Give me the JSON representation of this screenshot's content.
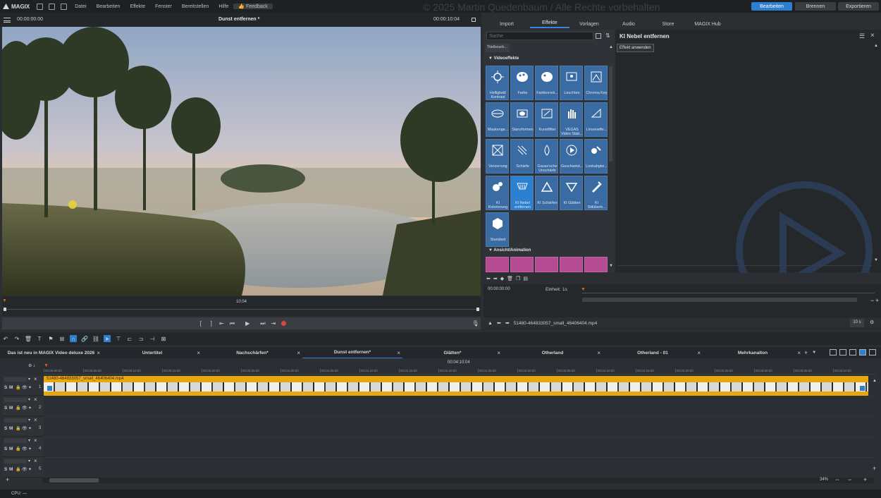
{
  "app": {
    "logo": "MAGIX",
    "watermark": "© 2025 Martin Quedenbaum / Alle Rechte vorbehalten"
  },
  "menu": {
    "items": [
      "Datei",
      "Bearbeiten",
      "Effekte",
      "Fenster",
      "Bereitstellen",
      "Hilfe"
    ],
    "feedback": "Feedback"
  },
  "modes": {
    "edit": "Bearbeiten",
    "burn": "Brennen",
    "export": "Exportieren"
  },
  "player": {
    "tc_left": "00:00:00:00",
    "title": "Dunst entfernen *",
    "tc_right": "00:00:10:04",
    "marker": "10:04"
  },
  "media_tabs": [
    "Import",
    "Effekte",
    "Vorlagen",
    "Audio",
    "Store",
    "MAGIX Hub"
  ],
  "fx": {
    "search_placeholder": "Suche",
    "crumb": "Titelbearb...",
    "section_video": "Videoeffekte",
    "section_anim": "Ansicht/Animation",
    "tiles": [
      "Helligkeit/ Kontrast",
      "Farbe",
      "Farbkorrek...",
      "Leuchten",
      "Chroma Key",
      "Maskenge...",
      "Stanzformen",
      "Kunstfilter",
      "VEGAS Video Stab...",
      "Linseneffe...",
      "Verzerrung",
      "Schärfe",
      "Gauss'sche Unschärfe",
      "Geschwind...",
      "Lookabglei...",
      "KI Kolorierung",
      "KI Nebel entfernen",
      "KI Schärfen",
      "KI Glätten",
      "KI Stilübertr...",
      "Standard"
    ]
  },
  "effect_panel": {
    "title": "KI Nebel entfernen",
    "apply": "Effekt anwenden"
  },
  "effect_timeline": {
    "tc": "00:00:00:00",
    "unit_label": "Einheit:",
    "unit_value": "1s",
    "file": "51480-464833057_small_46406404.mp4",
    "zoom": "10 s"
  },
  "project_tabs": [
    "Das ist neu in MAGIX Video deluxe 2026",
    "Untertitel",
    "Nachschärfen*",
    "Dunst entfernen*",
    "Glätten*",
    "Otherland",
    "Otherland - 01",
    "Mehrkanalton"
  ],
  "arranger": {
    "playhead_tc": "00:04:10:04",
    "ruler": [
      "00:00:00:00",
      "00:00:05:00",
      "00:00:10:00",
      "00:00:15:00",
      "00:00:20:00",
      "00:00:25:00",
      "00:01:00:00",
      "00:01:05:00",
      "00:01:10:00",
      "00:01:15:00",
      "00:01:20:00",
      "00:01:25:00",
      "00:02:00:00",
      "00:02:05:00",
      "00:02:10:00",
      "00:02:15:00",
      "00:02:20:00",
      "00:02:25:00",
      "00:03:00:00",
      "00:03:05:00",
      "00:03:10:00"
    ],
    "clip": "51480-464833057_small_46406404.mp4",
    "tracks": [
      "1",
      "2",
      "3",
      "4",
      "5"
    ],
    "zoom": "34%"
  },
  "status": {
    "cpu": "CPU: —"
  }
}
